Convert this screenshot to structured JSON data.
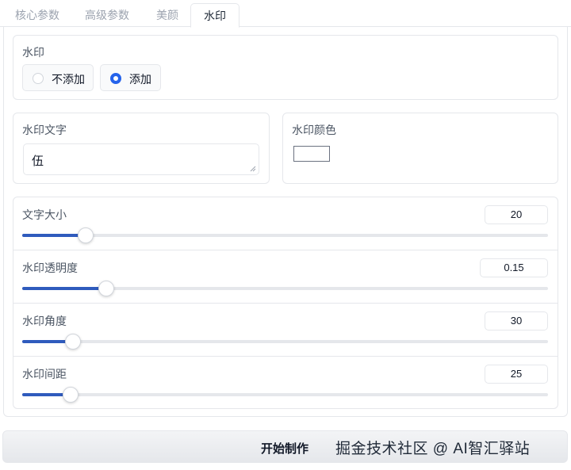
{
  "tabs": [
    {
      "label": "核心参数"
    },
    {
      "label": "高级参数"
    },
    {
      "label": "美颜"
    },
    {
      "label": "水印"
    }
  ],
  "watermark_toggle": {
    "label": "水印",
    "options": [
      {
        "label": "不添加",
        "selected": false
      },
      {
        "label": "添加",
        "selected": true
      }
    ]
  },
  "watermark_text": {
    "label": "水印文字",
    "value": "伍"
  },
  "watermark_color": {
    "label": "水印颜色",
    "value": "#ffffff"
  },
  "sliders": [
    {
      "label": "文字大小",
      "value": "20",
      "fraction": 0.12
    },
    {
      "label": "水印透明度",
      "value": "0.15",
      "fraction": 0.16
    },
    {
      "label": "水印角度",
      "value": "30",
      "fraction": 0.096
    },
    {
      "label": "水印间距",
      "value": "25",
      "fraction": 0.092
    }
  ],
  "start_button": {
    "label": "开始制作"
  },
  "overlay_watermark": "掘金技术社区 @ AI智汇驿站",
  "colors": {
    "accent": "#2f5bbd",
    "border": "#e5e7eb"
  }
}
